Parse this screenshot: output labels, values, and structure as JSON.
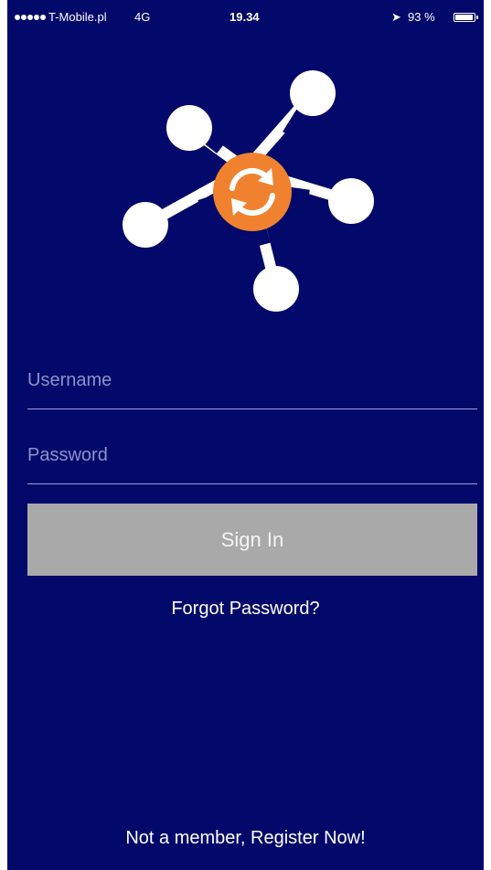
{
  "status_bar": {
    "carrier": "T-Mobile.pl",
    "network": "4G",
    "time": "19.34",
    "battery_text": "93 %",
    "battery_level": 0.93,
    "signal_bars": 5
  },
  "logo": {
    "icon": "network-sync-logo",
    "hub_color": "#f0822f",
    "node_color": "#ffffff"
  },
  "form": {
    "username_placeholder": "Username",
    "username_value": "",
    "password_placeholder": "Password",
    "password_value": "",
    "signin_label": "Sign In",
    "forgot_label": "Forgot Password?"
  },
  "footer": {
    "register_label": "Not a member, Register Now!"
  },
  "colors": {
    "background": "#02096a",
    "button": "#a9a9a9",
    "accent": "#f0822f"
  }
}
